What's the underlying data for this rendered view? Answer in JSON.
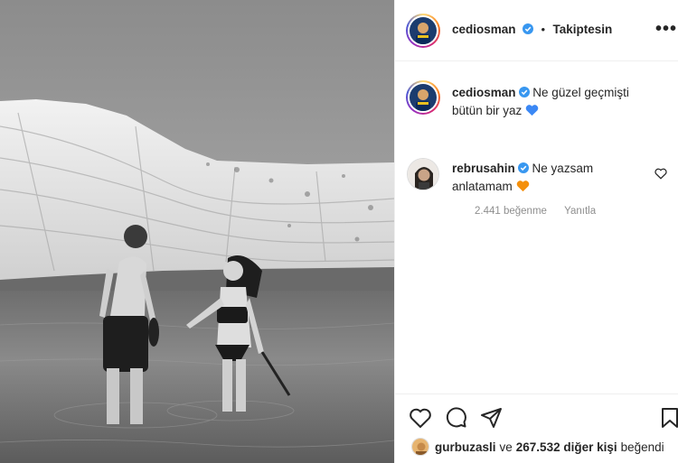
{
  "post": {
    "author": "cediosman",
    "follow_status": "Takiptesin",
    "more_label": "•••",
    "caption": "Ne güzel geçmişti bütün bir yaz"
  },
  "comment": {
    "author": "rebrusahin",
    "text": "Ne yazsam anlatamam",
    "likes": "2.441 beğenme",
    "reply_label": "Yanıtla"
  },
  "likes_summary": {
    "first_user": "gurbuzasli",
    "connector": "ve",
    "count_text": "267.532 diğer kişi",
    "suffix": "beğendi"
  },
  "icons": {
    "verified": "verified-badge-icon",
    "like": "heart-icon",
    "comment": "comment-icon",
    "share": "share-icon",
    "save": "bookmark-icon"
  },
  "colors": {
    "verified": "#3897f0",
    "blue_heart": "#3b88f5",
    "orange_heart": "#f4900c",
    "muted": "#8e8e8e"
  }
}
